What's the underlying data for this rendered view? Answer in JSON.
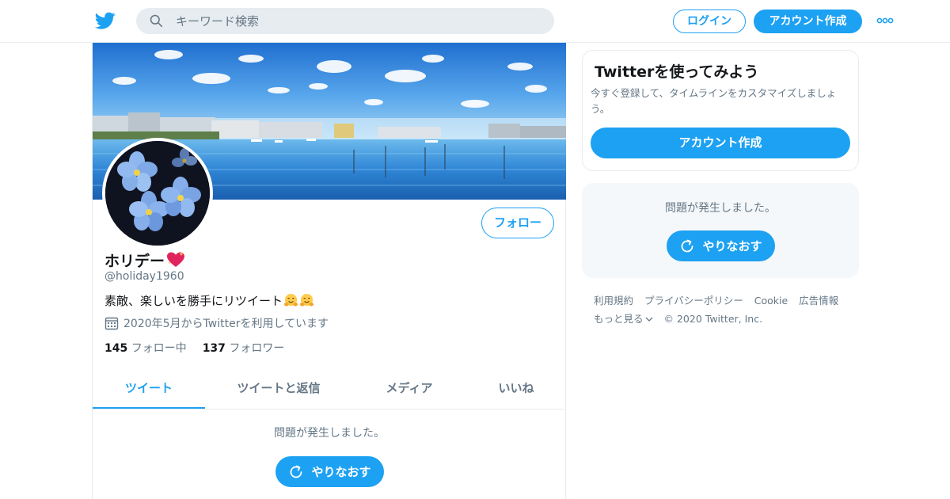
{
  "header": {
    "logo_icon": "twitter-bird-icon",
    "search_placeholder": "キーワード検索",
    "login_label": "ログイン",
    "signup_label": "アカウント作成",
    "more_icon": "more-dots-icon"
  },
  "profile": {
    "name": "ホリデー",
    "name_emoji_icon": "sparkling-heart-icon",
    "handle": "@holiday1960",
    "bio": "素敵、楽しいを勝手にリツイート",
    "bio_emoji_icon": "hugging-face-icon",
    "joined": "2020年5月からTwitterを利用しています",
    "following_count": "145",
    "following_label": "フォロー中",
    "followers_count": "137",
    "followers_label": "フォロワー",
    "follow_button": "フォロー"
  },
  "tabs": [
    {
      "label": "ツイート",
      "active": true
    },
    {
      "label": "ツイートと返信",
      "active": false
    },
    {
      "label": "メディア",
      "active": false
    },
    {
      "label": "いいね",
      "active": false
    }
  ],
  "timeline": {
    "error_text": "問題が発生しました。",
    "retry_label": "やりなおす"
  },
  "sidebar": {
    "card": {
      "title": "Twitterを使ってみよう",
      "description": "今すぐ登録して、タイムラインをカスタマイズしましょう。",
      "button": "アカウント作成"
    },
    "error_text": "問題が発生しました。",
    "retry_label": "やりなおす"
  },
  "footer": {
    "links": [
      "利用規約",
      "プライバシーポリシー",
      "Cookie",
      "広告情報"
    ],
    "more": "もっと見る",
    "copyright": "© 2020 Twitter, Inc."
  },
  "colors": {
    "accent": "#1da1f2",
    "secondary_text": "#657786",
    "border": "#e6ecf0"
  }
}
